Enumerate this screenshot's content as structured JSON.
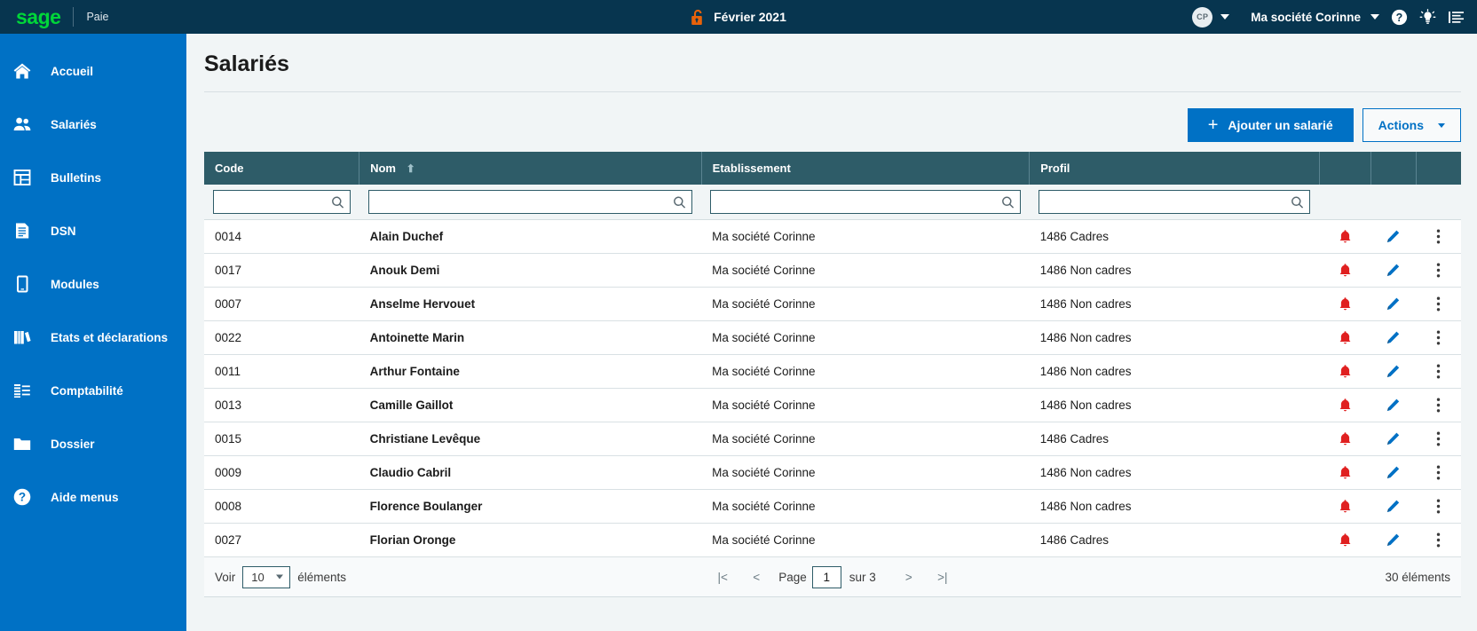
{
  "topbar": {
    "logo_text": "sage",
    "app_name": "Paie",
    "period": "Février 2021",
    "lock_icon": "unlocked-padlock-icon",
    "avatar_initials": "CP",
    "company": "Ma société Corinne",
    "help_icon": "help-circle-icon",
    "tips_icon": "lightbulb-icon",
    "menu_icon": "list-lines-icon"
  },
  "sidebar": {
    "items": [
      {
        "label": "Accueil",
        "icon": "home-icon"
      },
      {
        "label": "Salariés",
        "icon": "users-icon"
      },
      {
        "label": "Bulletins",
        "icon": "grid-table-icon"
      },
      {
        "label": "DSN",
        "icon": "document-icon"
      },
      {
        "label": "Modules",
        "icon": "tablet-icon"
      },
      {
        "label": "Etats et déclarations",
        "icon": "books-icon"
      },
      {
        "label": "Comptabilité",
        "icon": "ledger-lines-icon"
      },
      {
        "label": "Dossier",
        "icon": "folder-icon"
      },
      {
        "label": "Aide menus",
        "icon": "question-circle-icon"
      }
    ]
  },
  "main": {
    "page_title": "Salariés",
    "toolbar": {
      "add_label": "Ajouter un salarié",
      "add_icon": "plus-icon",
      "actions_label": "Actions",
      "actions_caret": "chevron-down-icon"
    },
    "table": {
      "columns": [
        {
          "label": "Code",
          "sorted": false
        },
        {
          "label": "Nom",
          "sorted": true,
          "sort_icon": "sort-ascending-arrow"
        },
        {
          "label": "Etablissement",
          "sorted": false
        },
        {
          "label": "Profil",
          "sorted": false
        }
      ],
      "filters": [
        {
          "value": "",
          "placeholder": "",
          "icon": "search-icon"
        },
        {
          "value": "",
          "placeholder": "",
          "icon": "search-icon"
        },
        {
          "value": "",
          "placeholder": "",
          "icon": "search-icon"
        },
        {
          "value": "",
          "placeholder": "",
          "icon": "search-icon"
        }
      ],
      "row_actions": {
        "alert_icon": "bell-icon",
        "edit_icon": "pencil-icon",
        "more_icon": "vertical-dots-icon"
      },
      "rows": [
        {
          "code": "0014",
          "nom": "Alain Duchef",
          "etablissement": "Ma société Corinne",
          "profil": "1486 Cadres"
        },
        {
          "code": "0017",
          "nom": "Anouk Demi",
          "etablissement": "Ma société Corinne",
          "profil": "1486 Non cadres"
        },
        {
          "code": "0007",
          "nom": "Anselme Hervouet",
          "etablissement": "Ma société Corinne",
          "profil": "1486 Non cadres"
        },
        {
          "code": "0022",
          "nom": "Antoinette Marin",
          "etablissement": "Ma société Corinne",
          "profil": "1486 Non cadres"
        },
        {
          "code": "0011",
          "nom": "Arthur Fontaine",
          "etablissement": "Ma société Corinne",
          "profil": "1486 Non cadres"
        },
        {
          "code": "0013",
          "nom": "Camille Gaillot",
          "etablissement": "Ma société Corinne",
          "profil": "1486 Non cadres"
        },
        {
          "code": "0015",
          "nom": "Christiane Levêque",
          "etablissement": "Ma société Corinne",
          "profil": "1486 Cadres"
        },
        {
          "code": "0009",
          "nom": "Claudio Cabril",
          "etablissement": "Ma société Corinne",
          "profil": "1486 Non cadres"
        },
        {
          "code": "0008",
          "nom": "Florence Boulanger",
          "etablissement": "Ma société Corinne",
          "profil": "1486 Non cadres"
        },
        {
          "code": "0027",
          "nom": "Florian Oronge",
          "etablissement": "Ma société Corinne",
          "profil": "1486 Cadres"
        }
      ]
    },
    "footer": {
      "voir_label": "Voir",
      "page_size": "10",
      "elements_label": "éléments",
      "first_label": "|<",
      "prev_label": "<",
      "page_label": "Page",
      "current_page": "1",
      "of_label": "sur 3",
      "next_label": ">",
      "last_label": ">|",
      "total_label": "30 éléments"
    }
  },
  "colors": {
    "topbar_bg": "#07354f",
    "sidebar_bg": "#0071c5",
    "accent_blue": "#0071c5",
    "logo_green": "#00d639",
    "table_header_bg": "#2e5c68",
    "alert_red": "#e02020",
    "lock_orange": "#e8620a"
  }
}
